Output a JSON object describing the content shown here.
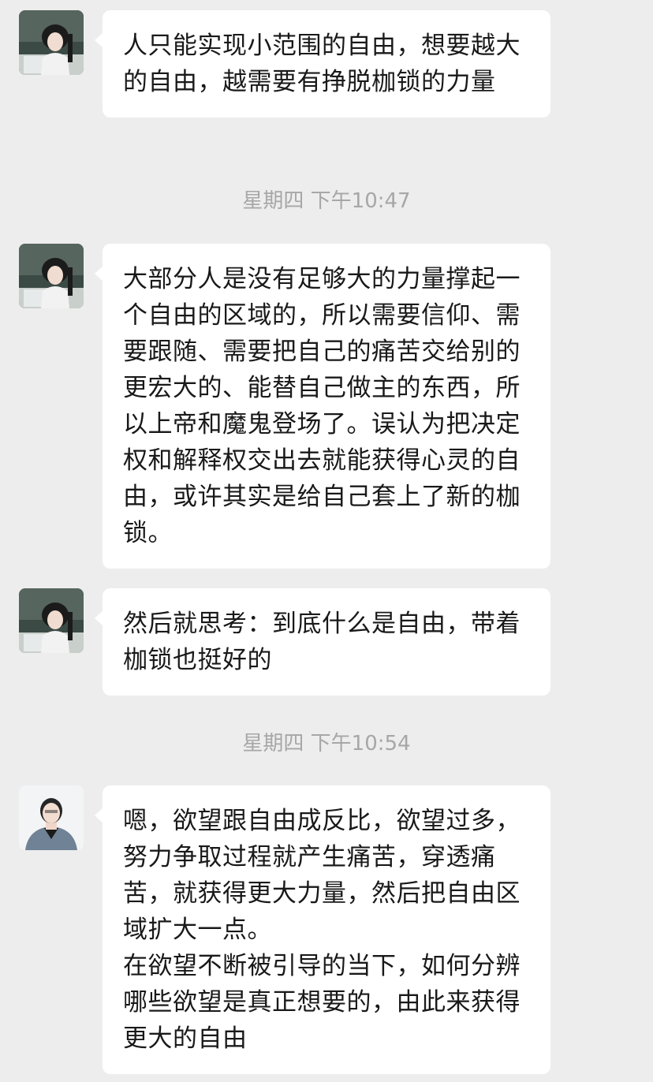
{
  "messages": [
    {
      "sender": "avatar-a",
      "text": "人只能实现小范围的自由，想要越大的自由，越需要有挣脱枷锁的力量"
    },
    {
      "timestamp": "星期四 下午10:47"
    },
    {
      "sender": "avatar-a",
      "text": "大部分人是没有足够大的力量撑起一个自由的区域的，所以需要信仰、需要跟随、需要把自己的痛苦交给别的更宏大的、能替自己做主的东西，所以上帝和魔鬼登场了。误认为把决定权和解释权交出去就能获得心灵的自由，或许其实是给自己套上了新的枷锁。"
    },
    {
      "sender": "avatar-a",
      "text": "然后就思考：到底什么是自由，带着枷锁也挺好的"
    },
    {
      "timestamp": "星期四 下午10:54"
    },
    {
      "sender": "avatar-b",
      "text": "嗯，欲望跟自由成反比，欲望过多，努力争取过程就产生痛苦，穿透痛苦，就获得更大力量，然后把自由区域扩大一点。\n在欲望不断被引导的当下，如何分辨哪些欲望是真正想要的，由此来获得更大的自由"
    }
  ],
  "colors": {
    "background": "#ededed",
    "bubble": "#ffffff",
    "text": "#191919",
    "timestamp": "#a7a7a7"
  }
}
